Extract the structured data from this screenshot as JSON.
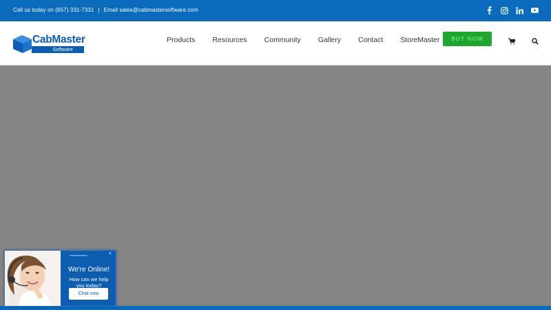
{
  "topbar": {
    "call_text": "Call us today on (657) 331-7331",
    "separator": "|",
    "email_text": "Email sales@cabmastersoftware.com",
    "social_icons": [
      "facebook-icon",
      "instagram-icon",
      "linkedin-icon",
      "youtube-icon"
    ]
  },
  "header": {
    "logo_line1": "CabMaster",
    "logo_line2": "Software",
    "nav": [
      "Products",
      "Resources",
      "Community",
      "Gallery",
      "Contact",
      "StoreMaster"
    ],
    "buy_label": "BUY NOW",
    "cart_icon": "cart-icon",
    "search_icon": "search-icon"
  },
  "chat": {
    "title": "We're Online!",
    "subtitle": "How can we help you today?",
    "button": "Chat now",
    "close": "×"
  },
  "colors": {
    "topbar": "#0a6bbd",
    "buy_button": "#1fa62f",
    "hero": "#858585"
  }
}
